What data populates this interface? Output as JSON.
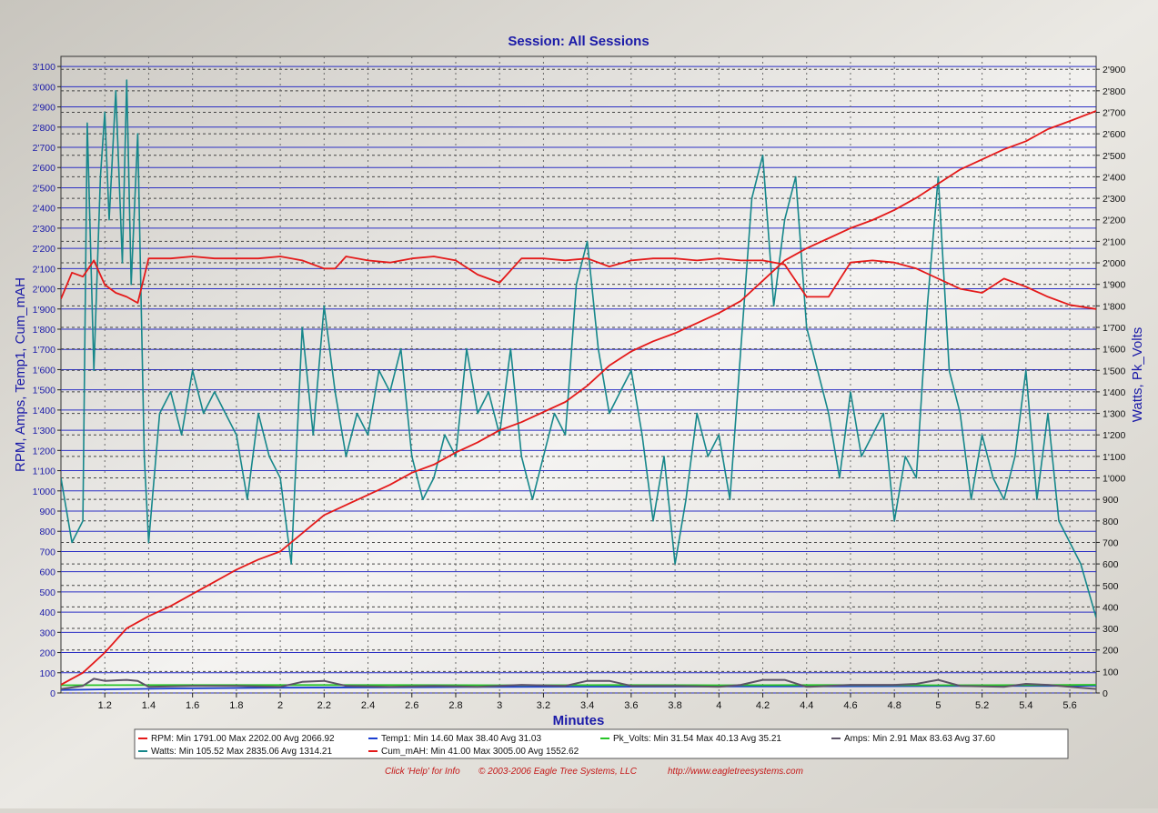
{
  "title": "Session: All Sessions",
  "footer": {
    "help": "Click 'Help' for Info",
    "copyright": "© 2003-2006 Eagle Tree Systems, LLC",
    "url": "http://www.eagletreesystems.com"
  },
  "legend": {
    "row1": [
      {
        "name": "RPM",
        "stats": "Min 1791.00 Max 2202.00 Avg 2066.92",
        "color": "#e41a1a"
      },
      {
        "name": "Temp1",
        "stats": "Min 14.60 Max 38.40 Avg 31.03",
        "color": "#1a3fd1"
      },
      {
        "name": "Pk_Volts",
        "stats": "Min 31.54 Max 40.13 Avg 35.21",
        "color": "#27c427"
      },
      {
        "name": "Amps",
        "stats": "Min 2.91 Max 83.63 Avg 37.60",
        "color": "#5e5468"
      }
    ],
    "row2": [
      {
        "name": "Watts",
        "stats": "Min 105.52 Max 2835.06 Avg 1314.21",
        "color": "#16878a"
      },
      {
        "name": "Cum_mAH",
        "stats": "Min 41.00 Max 3005.00 Avg 1552.62",
        "color": "#e41a1a"
      }
    ]
  },
  "chart_data": {
    "type": "line",
    "title": "Session: All Sessions",
    "xlabel": "Minutes",
    "ylabel_left": "RPM, Amps, Temp1, Cum_mAH",
    "ylabel_right": "Watts, Pk_Volts",
    "xlim": [
      1.0,
      5.72
    ],
    "ylim_left": [
      0,
      3150
    ],
    "ylim_right": [
      0,
      2960
    ],
    "x_ticks": [
      "1.2",
      "1.4",
      "1.6",
      "1.8",
      "2",
      "2.2",
      "2.4",
      "2.6",
      "2.8",
      "3",
      "3.2",
      "3.4",
      "3.6",
      "3.8",
      "4",
      "4.2",
      "4.4",
      "4.6",
      "4.8",
      "5",
      "5.2",
      "5.4",
      "5.6"
    ],
    "y_left_ticks": [
      "0",
      "100",
      "200",
      "300",
      "400",
      "500",
      "600",
      "700",
      "800",
      "900",
      "1'000",
      "1'100",
      "1'200",
      "1'300",
      "1'400",
      "1'500",
      "1'600",
      "1'700",
      "1'800",
      "1'900",
      "2'000",
      "2'100",
      "2'200",
      "2'300",
      "2'400",
      "2'500",
      "2'600",
      "2'700",
      "2'800",
      "2'900",
      "3'000",
      "3'100"
    ],
    "y_right_ticks": [
      "0",
      "100",
      "200",
      "300",
      "400",
      "500",
      "600",
      "700",
      "800",
      "900",
      "1'000",
      "1'100",
      "1'200",
      "1'300",
      "1'400",
      "1'500",
      "1'600",
      "1'700",
      "1'800",
      "1'900",
      "2'000",
      "2'100",
      "2'200",
      "2'300",
      "2'400",
      "2'500",
      "2'600",
      "2'700",
      "2'800",
      "2'900"
    ],
    "grid": true,
    "series": [
      {
        "name": "Cum_mAH",
        "axis": "left",
        "color": "#e41a1a",
        "x": [
          1.0,
          1.1,
          1.2,
          1.3,
          1.4,
          1.5,
          1.6,
          1.7,
          1.8,
          1.9,
          2.0,
          2.1,
          2.2,
          2.3,
          2.4,
          2.5,
          2.6,
          2.7,
          2.8,
          2.9,
          3.0,
          3.1,
          3.2,
          3.3,
          3.4,
          3.5,
          3.6,
          3.7,
          3.8,
          3.9,
          4.0,
          4.1,
          4.2,
          4.3,
          4.4,
          4.5,
          4.6,
          4.7,
          4.8,
          4.9,
          5.0,
          5.1,
          5.2,
          5.3,
          5.4,
          5.5,
          5.6,
          5.72
        ],
        "y": [
          41,
          100,
          200,
          320,
          380,
          430,
          490,
          550,
          610,
          660,
          700,
          790,
          880,
          930,
          980,
          1030,
          1090,
          1130,
          1190,
          1240,
          1300,
          1340,
          1390,
          1440,
          1520,
          1620,
          1690,
          1740,
          1780,
          1830,
          1880,
          1940,
          2040,
          2140,
          2200,
          2250,
          2300,
          2340,
          2390,
          2450,
          2520,
          2590,
          2640,
          2690,
          2730,
          2790,
          2830,
          2880
        ]
      },
      {
        "name": "RPM",
        "axis": "left",
        "color": "#e41a1a",
        "x": [
          1.0,
          1.05,
          1.1,
          1.15,
          1.2,
          1.25,
          1.3,
          1.35,
          1.4,
          1.5,
          1.6,
          1.7,
          1.8,
          1.9,
          2.0,
          2.1,
          2.2,
          2.25,
          2.3,
          2.4,
          2.5,
          2.6,
          2.7,
          2.8,
          2.9,
          3.0,
          3.1,
          3.2,
          3.3,
          3.4,
          3.5,
          3.6,
          3.7,
          3.8,
          3.9,
          4.0,
          4.1,
          4.2,
          4.3,
          4.4,
          4.5,
          4.6,
          4.7,
          4.8,
          4.9,
          5.0,
          5.1,
          5.2,
          5.3,
          5.4,
          5.5,
          5.6,
          5.72
        ],
        "y": [
          1950,
          2080,
          2060,
          2140,
          2020,
          1980,
          1960,
          1930,
          2150,
          2150,
          2160,
          2150,
          2150,
          2150,
          2160,
          2140,
          2100,
          2100,
          2160,
          2140,
          2130,
          2150,
          2160,
          2140,
          2070,
          2030,
          2150,
          2150,
          2140,
          2150,
          2110,
          2140,
          2150,
          2150,
          2140,
          2150,
          2140,
          2140,
          2120,
          1960,
          1960,
          2130,
          2140,
          2130,
          2100,
          2050,
          2000,
          1980,
          2050,
          2010,
          1960,
          1920,
          1900
        ]
      },
      {
        "name": "Watts",
        "axis": "right",
        "color": "#16878a",
        "x": [
          1.0,
          1.05,
          1.1,
          1.12,
          1.15,
          1.18,
          1.2,
          1.22,
          1.25,
          1.28,
          1.3,
          1.32,
          1.35,
          1.38,
          1.4,
          1.45,
          1.5,
          1.55,
          1.6,
          1.65,
          1.7,
          1.75,
          1.8,
          1.85,
          1.9,
          1.95,
          2.0,
          2.05,
          2.1,
          2.15,
          2.2,
          2.25,
          2.3,
          2.35,
          2.4,
          2.45,
          2.5,
          2.55,
          2.6,
          2.65,
          2.7,
          2.75,
          2.8,
          2.85,
          2.9,
          2.95,
          3.0,
          3.05,
          3.1,
          3.15,
          3.2,
          3.25,
          3.3,
          3.35,
          3.4,
          3.45,
          3.5,
          3.55,
          3.6,
          3.65,
          3.7,
          3.75,
          3.8,
          3.85,
          3.9,
          3.95,
          4.0,
          4.05,
          4.1,
          4.15,
          4.2,
          4.25,
          4.3,
          4.35,
          4.4,
          4.45,
          4.5,
          4.55,
          4.6,
          4.65,
          4.7,
          4.75,
          4.8,
          4.85,
          4.9,
          4.95,
          5.0,
          5.05,
          5.1,
          5.15,
          5.2,
          5.25,
          5.3,
          5.35,
          5.4,
          5.45,
          5.5,
          5.55,
          5.6,
          5.65,
          5.72
        ],
        "y": [
          1000,
          700,
          800,
          2650,
          1500,
          2400,
          2700,
          2200,
          2800,
          2000,
          2850,
          1900,
          2600,
          1100,
          700,
          1300,
          1400,
          1200,
          1500,
          1300,
          1400,
          1300,
          1200,
          900,
          1300,
          1100,
          1000,
          600,
          1700,
          1200,
          1800,
          1400,
          1100,
          1300,
          1200,
          1500,
          1400,
          1600,
          1100,
          900,
          1000,
          1200,
          1100,
          1600,
          1300,
          1400,
          1200,
          1600,
          1100,
          900,
          1100,
          1300,
          1200,
          1900,
          2100,
          1600,
          1300,
          1400,
          1500,
          1200,
          800,
          1100,
          600,
          900,
          1300,
          1100,
          1200,
          900,
          1600,
          2300,
          2500,
          1800,
          2200,
          2400,
          1700,
          1500,
          1300,
          1000,
          1400,
          1100,
          1200,
          1300,
          800,
          1100,
          1000,
          1800,
          2400,
          1500,
          1300,
          900,
          1200,
          1000,
          900,
          1100,
          1500,
          900,
          1300,
          800,
          700,
          600,
          350
        ]
      },
      {
        "name": "Amps",
        "axis": "left",
        "color": "#5e5468",
        "x": [
          1.0,
          1.1,
          1.15,
          1.2,
          1.3,
          1.35,
          1.4,
          1.6,
          1.8,
          2.0,
          2.1,
          2.2,
          2.3,
          2.5,
          2.7,
          2.9,
          3.1,
          3.3,
          3.4,
          3.5,
          3.6,
          3.8,
          4.0,
          4.1,
          4.2,
          4.3,
          4.4,
          4.6,
          4.8,
          4.9,
          5.0,
          5.1,
          5.3,
          5.4,
          5.5,
          5.6,
          5.72
        ],
        "y": [
          20,
          35,
          70,
          60,
          65,
          60,
          30,
          35,
          35,
          30,
          55,
          60,
          35,
          30,
          35,
          30,
          40,
          35,
          60,
          60,
          35,
          35,
          30,
          40,
          65,
          65,
          30,
          40,
          40,
          45,
          65,
          35,
          30,
          45,
          40,
          30,
          20
        ]
      },
      {
        "name": "Pk_Volts",
        "axis": "right",
        "color": "#27c427",
        "x": [
          1.0,
          1.5,
          2.0,
          2.5,
          3.0,
          3.5,
          4.0,
          4.5,
          5.0,
          5.5,
          5.72
        ],
        "y": [
          36,
          37,
          37,
          37,
          36,
          37,
          36,
          37,
          36,
          37,
          38
        ]
      },
      {
        "name": "Temp1",
        "axis": "left",
        "color": "#1a3fd1",
        "x": [
          1.0,
          1.5,
          2.0,
          2.5,
          3.0,
          3.5,
          4.0,
          4.5,
          5.0,
          5.5,
          5.72
        ],
        "y": [
          15,
          22,
          26,
          28,
          30,
          31,
          32,
          33,
          34,
          35,
          36
        ]
      }
    ]
  }
}
